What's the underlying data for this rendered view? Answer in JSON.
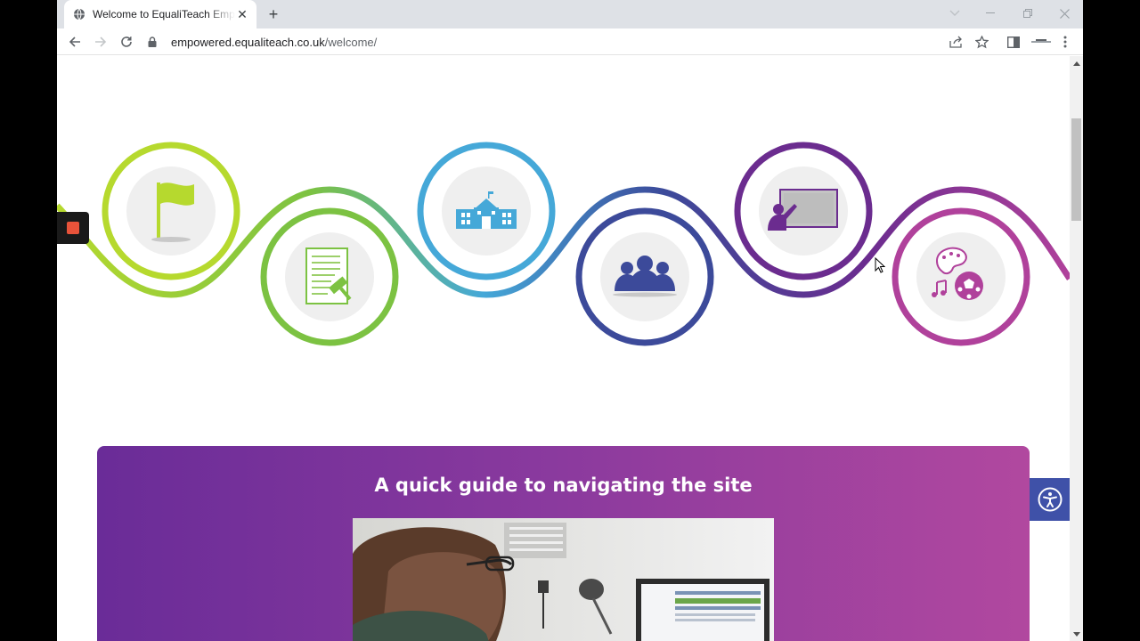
{
  "browser": {
    "tab_title": "Welcome to EqualiTeach Empowered",
    "url_host": "empowered.equaliteach.co.uk",
    "url_path": "/welcome/"
  },
  "journey": {
    "colors": [
      "#b6d92e",
      "#7cc242",
      "#45a8d8",
      "#3c4a9a",
      "#6b2c8f",
      "#b0419b"
    ],
    "icons": [
      "flag-icon",
      "legal-document-icon",
      "school-icon",
      "people-group-icon",
      "teacher-presentation-icon",
      "arts-music-sport-icon"
    ]
  },
  "guide": {
    "title": "A quick guide to navigating the site"
  },
  "colors": {
    "accent_purple": "#6a2c98",
    "accent_pink": "#b1489f",
    "accessibility_blue": "#3f51a8",
    "record_red": "#e8533a"
  }
}
